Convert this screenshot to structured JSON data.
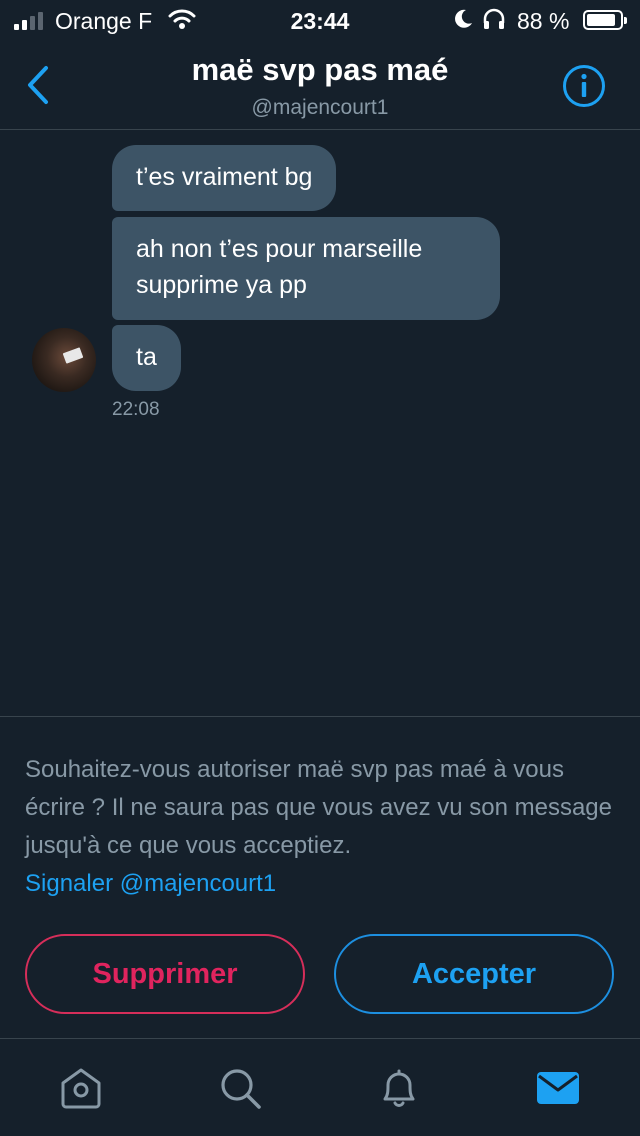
{
  "status_bar": {
    "carrier": "Orange F",
    "time": "23:44",
    "battery_percent": "88 %",
    "battery_level": 0.88,
    "signal_bars_filled": 2,
    "signal_bars_total": 4
  },
  "header": {
    "title": "maë svp pas maé",
    "handle": "@majencourt1"
  },
  "conversation": {
    "messages": [
      {
        "text": "t’es vraiment bg"
      },
      {
        "text": "ah non t’es pour marseille supprime ya pp"
      },
      {
        "text": "ta"
      }
    ],
    "timestamp": "22:08"
  },
  "request": {
    "prompt": "Souhaitez-vous autoriser maë svp pas maé à vous écrire ? Il ne saura pas que vous avez vu son message jusqu'à ce que vous acceptiez.",
    "report_link": "Signaler @majencourt1",
    "delete_label": "Supprimer",
    "accept_label": "Accepter"
  },
  "tab_bar": {
    "tabs": [
      "home-icon",
      "search-icon",
      "notifications-icon",
      "messages-icon"
    ],
    "active": "messages-icon"
  },
  "colors": {
    "background": "#15202b",
    "bubble": "#3d5466",
    "accent": "#1da1f2",
    "danger": "#e0245e",
    "muted_text": "#8899a6",
    "divider": "#38444d"
  }
}
